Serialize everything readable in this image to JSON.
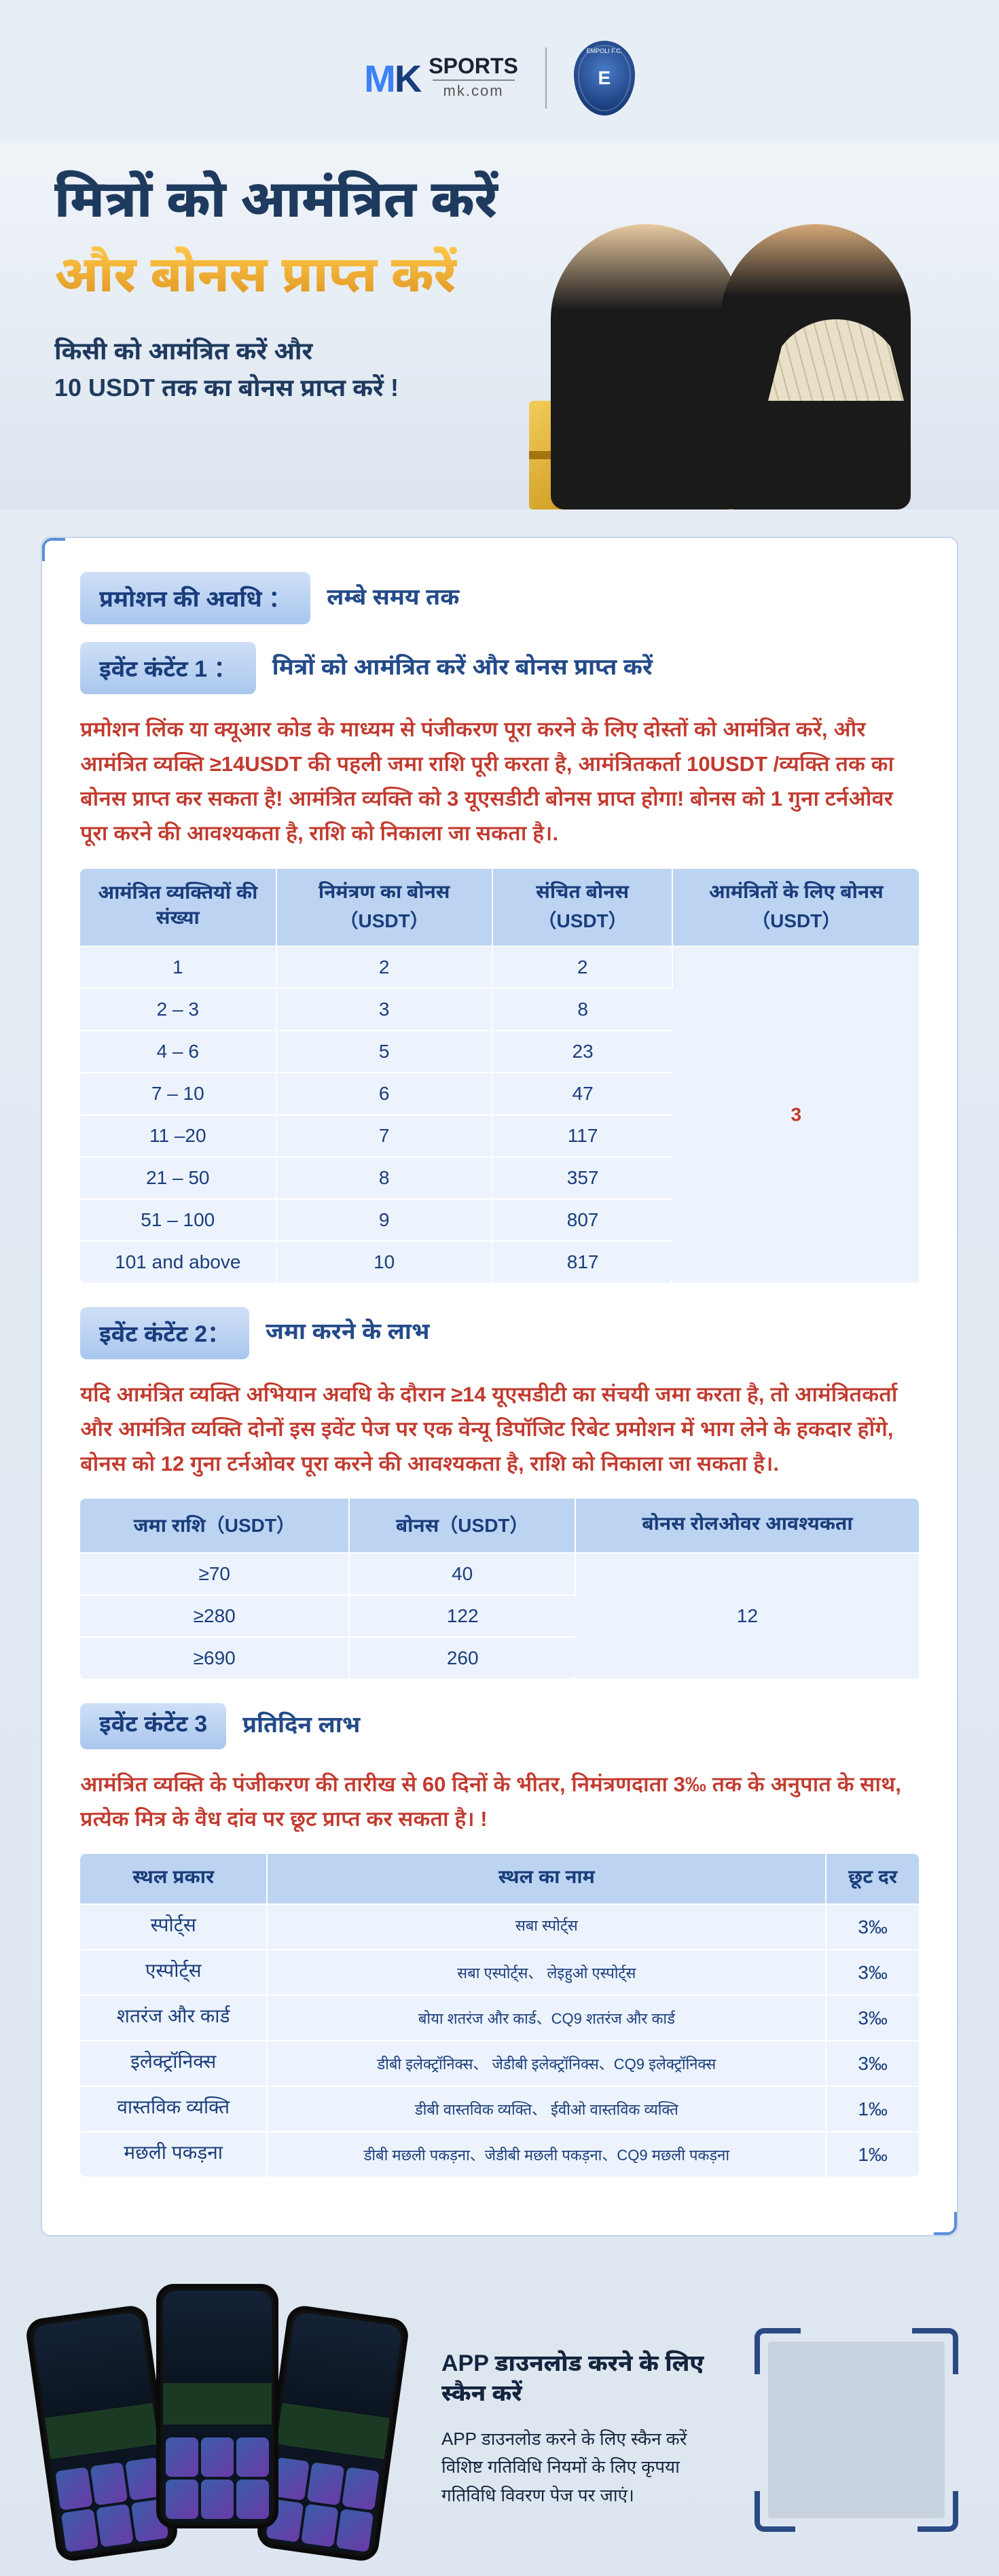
{
  "header": {
    "logo_mk": "MK",
    "logo_sports": "SPORTS",
    "logo_domain": "mk.com",
    "club_badge_text": "EMPOLI F.C."
  },
  "hero": {
    "title_line1": "मित्रों को आमंत्रित करें",
    "title_line2": "और बोनस प्राप्त करें",
    "subtitle": "किसी को आमंत्रित करें और\n10 USDT तक का बोनस प्राप्त करें !"
  },
  "sections": {
    "period": {
      "label": "प्रमोशन की अवधि ：",
      "value": "लम्बे समय तक"
    },
    "event1": {
      "label": "इवेंट कंटेंट 1 ：",
      "value": "मित्रों को आमंत्रित करें और बोनस प्राप्त करें",
      "body": "प्रमोशन लिंक या क्यूआर कोड के माध्यम से पंजीकरण पूरा करने के लिए दोस्तों को आमंत्रित करें, और आमंत्रित व्यक्ति ≥14USDT की पहली जमा राशि पूरी करता है, आमंत्रितकर्ता 10USDT /व्यक्ति तक का बोनस प्राप्त कर सकता है! आमंत्रित व्यक्ति को 3 यूएसडीटी बोनस प्राप्त होगा! बोनस को 1 गुना टर्नओवर पूरा करने की आवश्यकता है, राशि को निकाला जा सकता है।.",
      "table": {
        "headers": [
          "आमंत्रित व्यक्तियों की संख्या",
          "निमंत्रण का बोनस （USDT）",
          "संचित बोनस（USDT）",
          "आमंत्रितों के लिए बोनस（USDT）"
        ],
        "rows": [
          [
            "1",
            "2",
            "2"
          ],
          [
            "2 – 3",
            "3",
            "8"
          ],
          [
            "4 – 6",
            "5",
            "23"
          ],
          [
            "7 – 10",
            "6",
            "47"
          ],
          [
            "11 –20",
            "7",
            "117"
          ],
          [
            "21 – 50",
            "8",
            "357"
          ],
          [
            "51 – 100",
            "9",
            "807"
          ],
          [
            "101 and above",
            "10",
            "817"
          ]
        ],
        "merged_last": "3"
      }
    },
    "event2": {
      "label": "इवेंट कंटेंट 2：",
      "value": "जमा करने के लाभ",
      "body": "यदि आमंत्रित व्यक्ति अभियान अवधि के दौरान ≥14 यूएसडीटी का संचयी जमा करता है, तो आमंत्रितकर्ता और आमंत्रित व्यक्ति दोनों इस इवेंट पेज पर एक वेन्यू डिपॉजिट रिबेट प्रमोशन में भाग लेने के हकदार होंगे, बोनस को 12 गुना टर्नओवर पूरा करने की आवश्यकता है, राशि को निकाला जा सकता है।.",
      "table": {
        "headers": [
          "जमा राशि（USDT）",
          "बोनस（USDT）",
          "बोनस रोलओवर आवश्यकता"
        ],
        "rows": [
          [
            "≥70",
            "40"
          ],
          [
            "≥280",
            "122"
          ],
          [
            "≥690",
            "260"
          ]
        ],
        "merged_last": "12"
      }
    },
    "event3": {
      "label": "इवेंट कंटेंट 3",
      "value": "प्रतिदिन लाभ",
      "body": "आमंत्रित व्यक्ति के पंजीकरण की तारीख से 60 दिनों के भीतर, निमंत्रणदाता 3‰ तक के अनुपात के साथ, प्रत्येक मित्र के वैध दांव पर छूट प्राप्त कर सकता है। !",
      "table": {
        "headers": [
          "स्थल प्रकार",
          "स्थल का नाम",
          "छूट दर"
        ],
        "rows": [
          [
            "स्पोर्ट्स",
            "सबा स्पोर्ट्स",
            "3‰"
          ],
          [
            "एस्पोर्ट्स",
            "सबा एस्पोर्ट्स、 लेइहुओ एस्पोर्ट्स",
            "3‰"
          ],
          [
            "शतरंज और कार्ड",
            "बोया शतरंज और कार्ड、CQ9 शतरंज और कार्ड",
            "3‰"
          ],
          [
            "इलेक्ट्रॉनिक्स",
            "डीबी इलेक्ट्रॉनिक्स、 जेडीबी इलेक्ट्रॉनिक्स、CQ9 इलेक्ट्रॉनिक्स",
            "3‰"
          ],
          [
            "वास्तविक व्यक्ति",
            "डीबी वास्तविक व्यक्ति、 ईवीओ वास्तविक व्यक्ति",
            "1‰"
          ],
          [
            "मछली पकड़ना",
            "डीबी मछली पकड़ना、जेडीबी मछली पकड़ना、CQ9 मछली पकड़ना",
            "1‰"
          ]
        ]
      }
    }
  },
  "footer": {
    "title": "APP  डाउनलोड करने के लिए स्कैन करें",
    "body": "APP  डाउनलोड करने के लिए स्कैन करें\nविशिष्ट गतिविधि नियमों के लिए कृपया गतिविधि विवरण पेज पर जाएं।"
  }
}
